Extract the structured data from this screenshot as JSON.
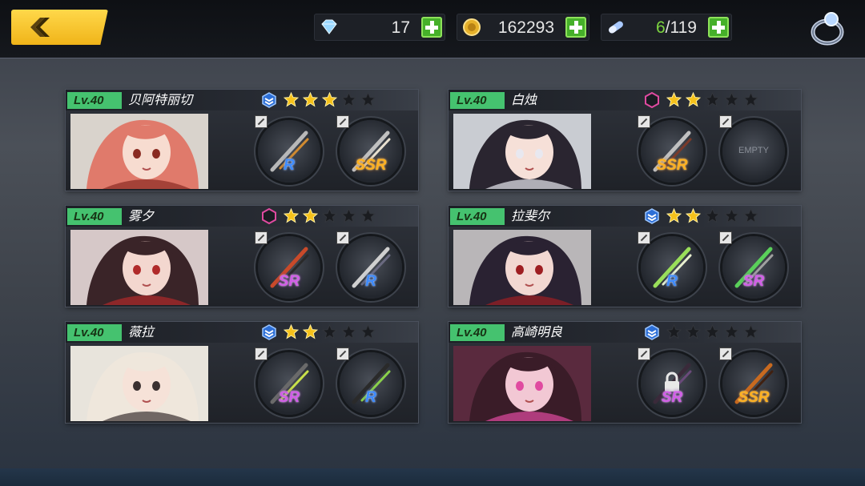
{
  "resources": {
    "diamonds": "17",
    "gold": "162293",
    "stamina_current": "6",
    "stamina_max": "/119"
  },
  "icons": {
    "back": "chevron-left-icon",
    "diamond": "diamond-icon",
    "gold": "coin-icon",
    "stamina": "capsule-icon",
    "settings": "ring-icon",
    "add": "plus-icon",
    "edit": "pencil-icon",
    "lock": "lock-icon"
  },
  "colors": {
    "accent_yellow": "#f0b419",
    "level_green": "#45c26f",
    "plus_green": "#46b02a",
    "star_gold": "#f6c21b",
    "rarity_r": "#3d8bff",
    "rarity_sr": "#d25ce8",
    "rarity_ssr": "#ffb020"
  },
  "characters": [
    {
      "level": "Lv.40",
      "name": "贝阿特丽切",
      "rank_icon": "blue-chevron-icon",
      "stars": 3,
      "max_stars": 5,
      "slot1": {
        "rarity": "R"
      },
      "slot2": {
        "rarity": "SSR"
      }
    },
    {
      "level": "Lv.40",
      "name": "白烛",
      "rank_icon": "pink-hexagon-icon",
      "stars": 2,
      "max_stars": 5,
      "slot1": {
        "rarity": "SSR"
      },
      "slot2": {
        "empty_label": "EMPTY"
      }
    },
    {
      "level": "Lv.40",
      "name": "雾夕",
      "rank_icon": "pink-hexagon-icon",
      "stars": 2,
      "max_stars": 5,
      "slot1": {
        "rarity": "SR"
      },
      "slot2": {
        "rarity": "R"
      }
    },
    {
      "level": "Lv.40",
      "name": "拉斐尔",
      "rank_icon": "blue-chevron-icon",
      "stars": 2,
      "max_stars": 5,
      "slot1": {
        "rarity": "R"
      },
      "slot2": {
        "rarity": "SR"
      }
    },
    {
      "level": "Lv.40",
      "name": "薇拉",
      "rank_icon": "blue-chevron-icon",
      "stars": 2,
      "max_stars": 5,
      "slot1": {
        "rarity": "SR"
      },
      "slot2": {
        "rarity": "R"
      }
    },
    {
      "level": "Lv.40",
      "name": "高崎明良",
      "rank_icon": "blue-chevron-icon",
      "stars": 0,
      "max_stars": 5,
      "slot1": {
        "rarity": "SR",
        "locked": true
      },
      "slot2": {
        "rarity": "SSR"
      }
    }
  ]
}
